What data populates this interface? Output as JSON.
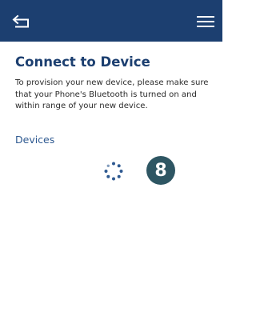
{
  "header": {
    "bg_color": "#1c3f70",
    "back_icon": "back-arrow-icon",
    "menu_icon": "hamburger-menu-icon"
  },
  "main": {
    "title": "Connect to Device",
    "description": "To provision your new device, please make sure that your Phone's Bluetooth is turned on and within range of your new device.",
    "devices_label": "Devices",
    "loading_icon": "loading-spinner-icon",
    "step_badge": "8"
  },
  "colors": {
    "title": "#1c3f70",
    "link": "#2f5a91",
    "badge": "#2e5663"
  }
}
